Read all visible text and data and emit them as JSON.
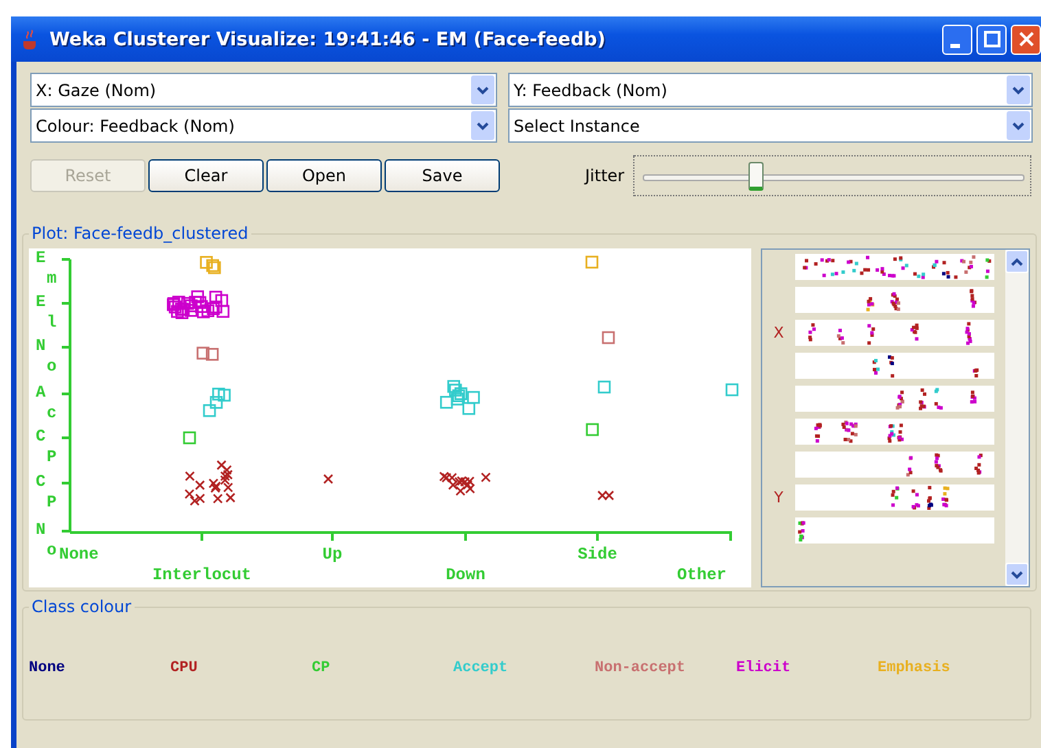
{
  "window": {
    "title": "Weka Clusterer Visualize: 19:41:46 - EM (Face-feedb)"
  },
  "selectors": [
    {
      "value": "X: Gaze (Nom)"
    },
    {
      "value": "Y: Feedback (Nom)"
    },
    {
      "value": "Colour: Feedback (Nom)"
    },
    {
      "value": "Select Instance"
    }
  ],
  "buttons": [
    {
      "label": "Reset",
      "disabled": true
    },
    {
      "label": "Clear",
      "disabled": false
    },
    {
      "label": "Open",
      "disabled": false
    },
    {
      "label": "Save",
      "disabled": false
    }
  ],
  "jitter": {
    "label": "Jitter",
    "level": 0.3
  },
  "plot": {
    "title": "Plot: Face-feedb_clustered",
    "y_labels": [
      "Em",
      "El",
      "No",
      "Ac",
      "CP",
      "CP",
      "No"
    ],
    "x_labels": [
      "None",
      "Interlocut",
      "Up",
      "Down",
      "Side",
      "Other"
    ]
  },
  "attribute_panel": {
    "x_marker": "X",
    "y_marker": "Y"
  },
  "class_colour": {
    "title": "Class colour",
    "classes": [
      {
        "name": "None",
        "color": "#000080"
      },
      {
        "name": "CPU",
        "color": "#b22222"
      },
      {
        "name": "CP",
        "color": "#33cc33"
      },
      {
        "name": "Accept",
        "color": "#33cccc"
      },
      {
        "name": "Non-accept",
        "color": "#c87070"
      },
      {
        "name": "Elicit",
        "color": "#cc00cc"
      },
      {
        "name": "Emphasis",
        "color": "#e8b020"
      }
    ]
  }
}
